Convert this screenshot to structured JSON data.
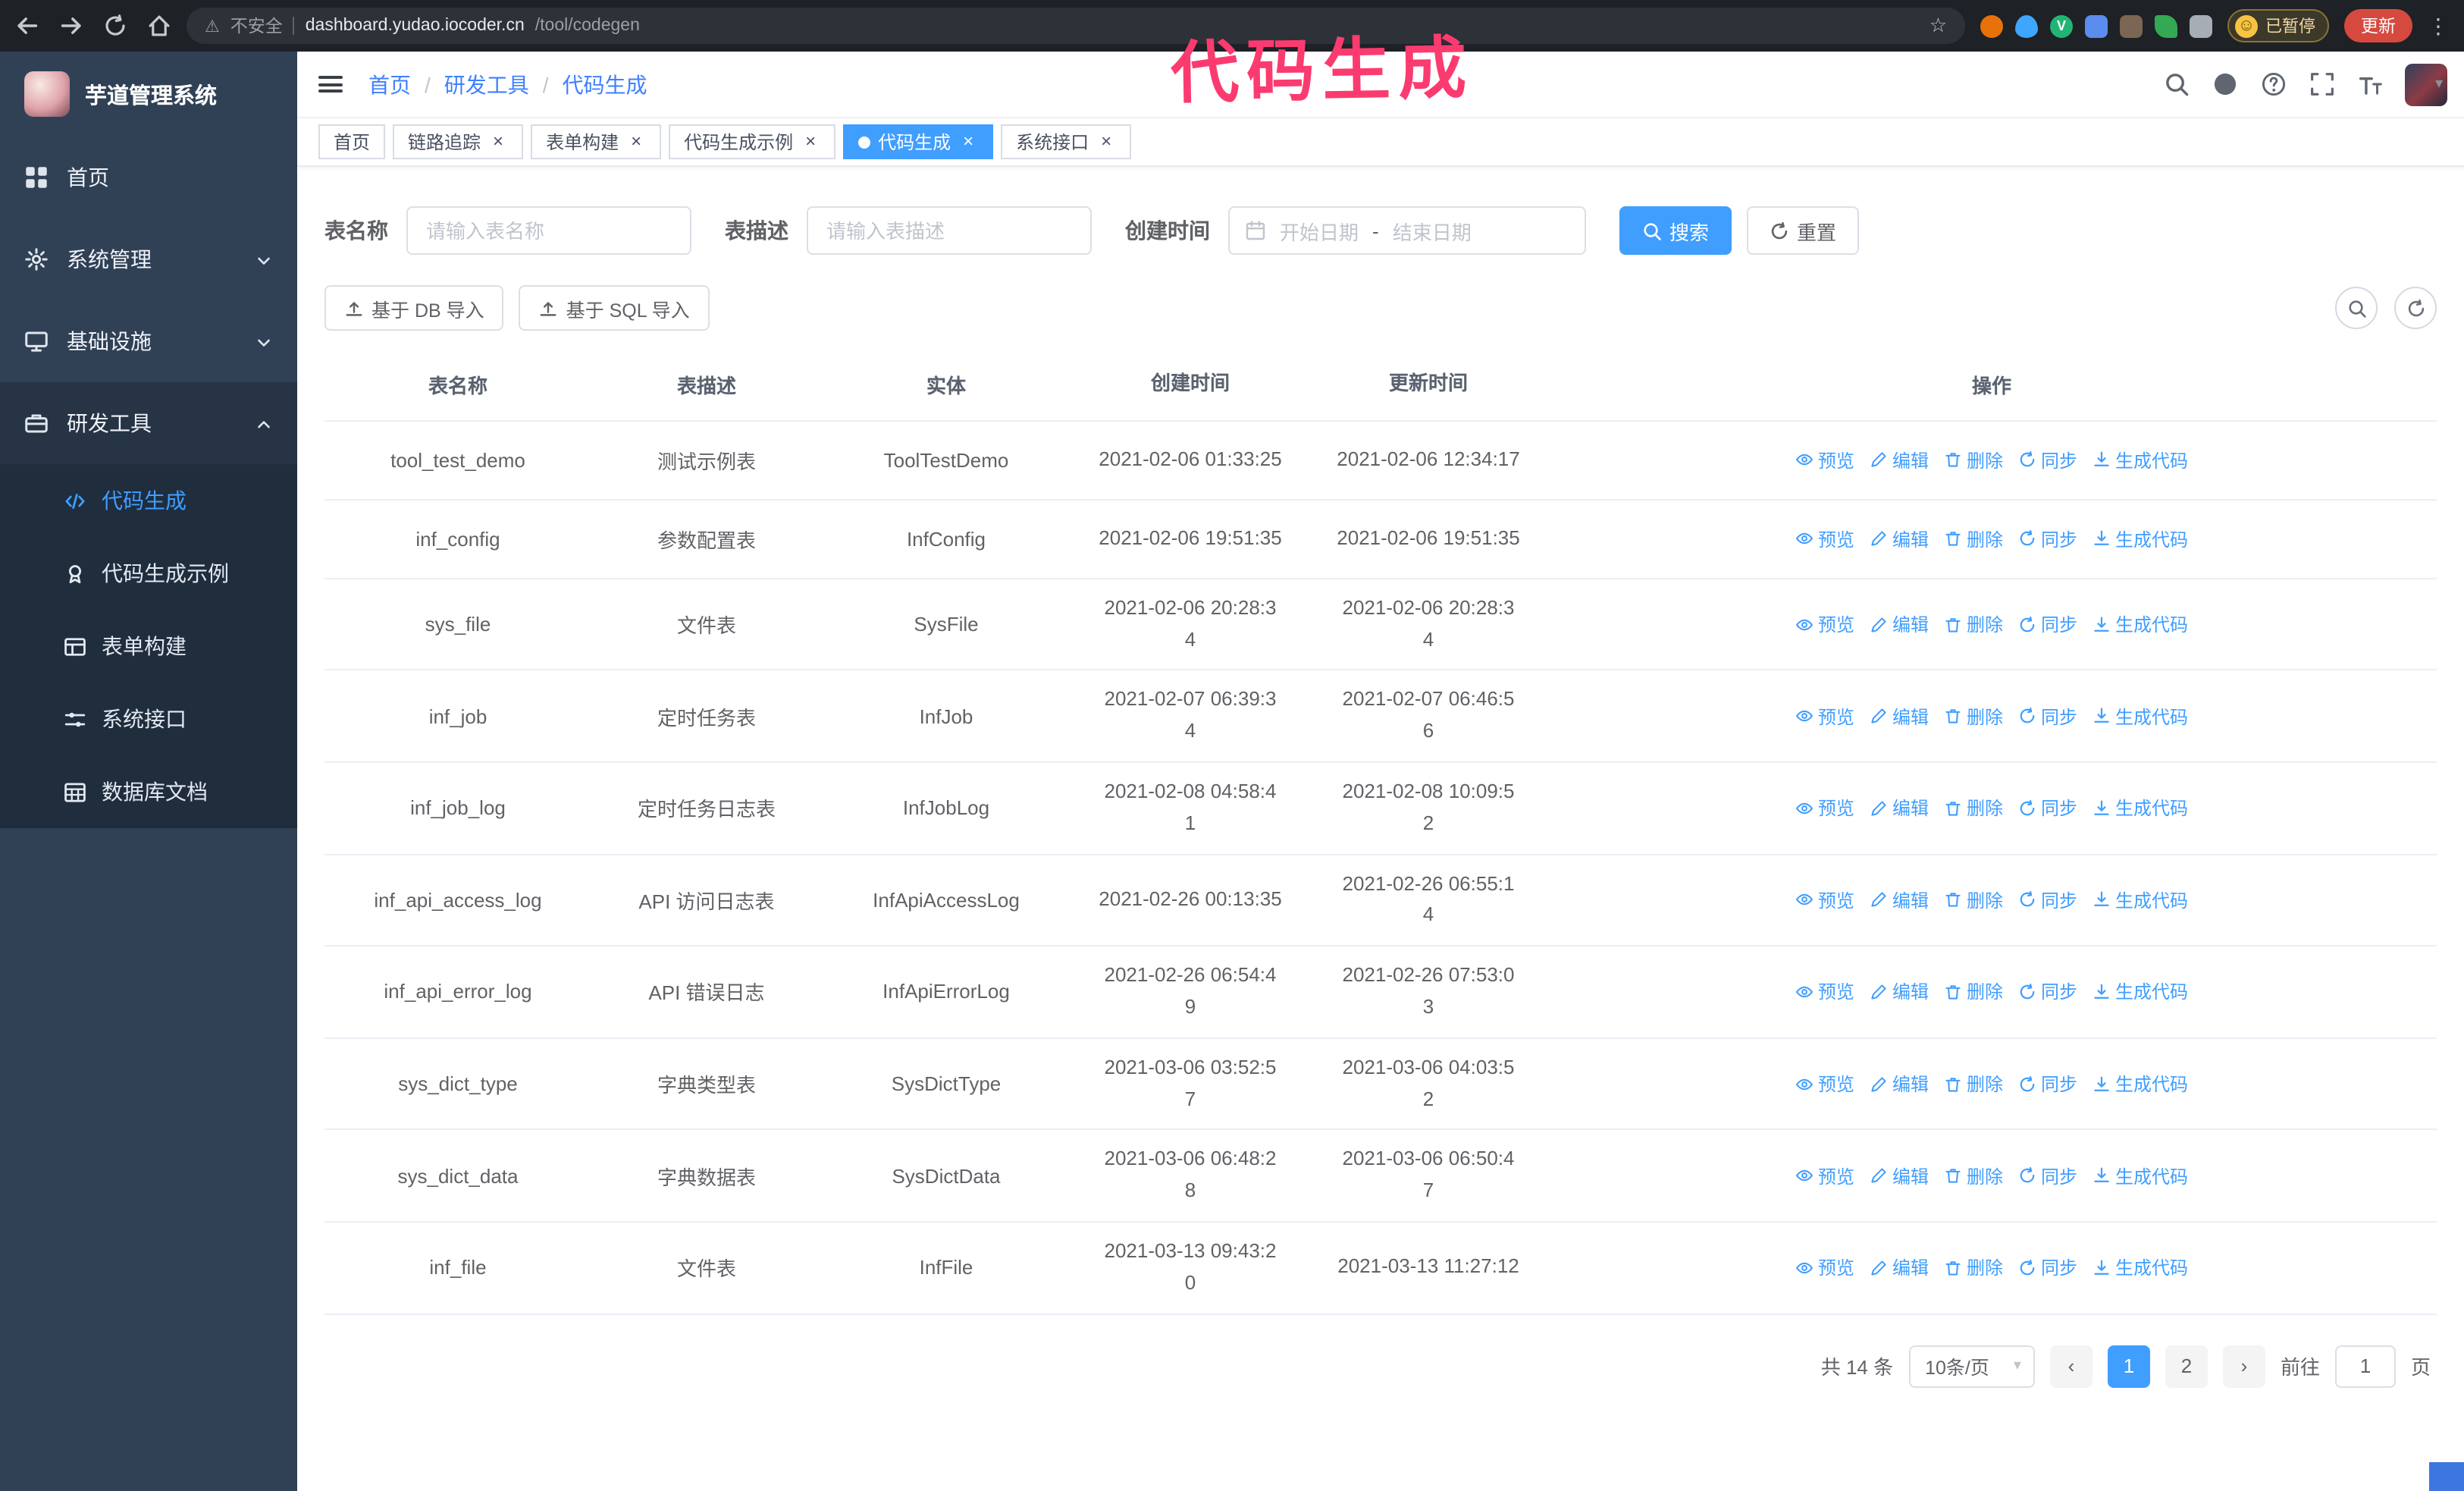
{
  "annotation": "代码生成",
  "browser": {
    "nav_icons": [
      "back-icon",
      "forward-icon",
      "refresh-icon",
      "home-icon"
    ],
    "insecure_label": "不安全",
    "url_host": "dashboard.yudao.iocoder.cn",
    "url_path": "/tool/codegen",
    "extension_icons": [
      "fox-icon",
      "droplet-icon",
      "vpn-icon",
      "users-icon",
      "screen-icon",
      "leaf-icon",
      "puzzle-icon"
    ],
    "paused_badge": "已暂停",
    "update_button": "更新"
  },
  "sidebar": {
    "logo_title": "芋道管理系统",
    "items": [
      {
        "label": "首页",
        "icon": "dashboard-icon"
      },
      {
        "label": "系统管理",
        "icon": "gear-icon",
        "chevron": "down"
      },
      {
        "label": "基础设施",
        "icon": "infra-icon",
        "chevron": "down"
      },
      {
        "label": "研发工具",
        "icon": "tools-icon",
        "chevron": "up",
        "expanded": true,
        "children": [
          {
            "label": "代码生成",
            "icon": "code-icon",
            "active": true
          },
          {
            "label": "代码生成示例",
            "icon": "example-icon"
          },
          {
            "label": "表单构建",
            "icon": "form-icon"
          },
          {
            "label": "系统接口",
            "icon": "api-icon"
          },
          {
            "label": "数据库文档",
            "icon": "dbdoc-icon"
          }
        ]
      }
    ]
  },
  "header": {
    "breadcrumb": [
      "首页",
      "研发工具",
      "代码生成"
    ],
    "icons": [
      "search-icon",
      "github-icon",
      "help-icon",
      "fullscreen-icon",
      "font-size-icon"
    ]
  },
  "tags": [
    {
      "label": "首页",
      "closable": false,
      "active": false
    },
    {
      "label": "链路追踪",
      "closable": true,
      "active": false
    },
    {
      "label": "表单构建",
      "closable": true,
      "active": false
    },
    {
      "label": "代码生成示例",
      "closable": true,
      "active": false
    },
    {
      "label": "代码生成",
      "closable": true,
      "active": true
    },
    {
      "label": "系统接口",
      "closable": true,
      "active": false
    }
  ],
  "filters": {
    "name_label": "表名称",
    "name_placeholder": "请输入表名称",
    "desc_label": "表描述",
    "desc_placeholder": "请输入表描述",
    "time_label": "创建时间",
    "start_placeholder": "开始日期",
    "range_separator": "-",
    "end_placeholder": "结束日期",
    "search_label": "搜索",
    "reset_label": "重置"
  },
  "toolbar": {
    "db_import": "基于 DB 导入",
    "sql_import": "基于 SQL 导入"
  },
  "table": {
    "columns": [
      "表名称",
      "表描述",
      "实体",
      "创建时间",
      "更新时间",
      "操作"
    ],
    "actions": [
      {
        "name": "preview",
        "label": "预览",
        "icon": "eye-icon"
      },
      {
        "name": "edit",
        "label": "编辑",
        "icon": "edit-icon"
      },
      {
        "name": "delete",
        "label": "删除",
        "icon": "delete-icon"
      },
      {
        "name": "sync",
        "label": "同步",
        "icon": "sync-icon"
      },
      {
        "name": "generate-code",
        "label": "生成代码",
        "icon": "download-icon"
      }
    ],
    "rows": [
      {
        "name": "tool_test_demo",
        "desc": "测试示例表",
        "entity": "ToolTestDemo",
        "created": "2021-02-06 01:33:25",
        "updated": "2021-02-06 12:34:17"
      },
      {
        "name": "inf_config",
        "desc": "参数配置表",
        "entity": "InfConfig",
        "created": "2021-02-06 19:51:35",
        "updated": "2021-02-06 19:51:35"
      },
      {
        "name": "sys_file",
        "desc": "文件表",
        "entity": "SysFile",
        "created": "2021-02-06 20:28:3\n4",
        "updated": "2021-02-06 20:28:3\n4"
      },
      {
        "name": "inf_job",
        "desc": "定时任务表",
        "entity": "InfJob",
        "created": "2021-02-07 06:39:3\n4",
        "updated": "2021-02-07 06:46:5\n6"
      },
      {
        "name": "inf_job_log",
        "desc": "定时任务日志表",
        "entity": "InfJobLog",
        "created": "2021-02-08 04:58:4\n1",
        "updated": "2021-02-08 10:09:5\n2"
      },
      {
        "name": "inf_api_access_log",
        "desc": "API 访问日志表",
        "entity": "InfApiAccessLog",
        "created": "2021-02-26 00:13:35",
        "updated": "2021-02-26 06:55:1\n4"
      },
      {
        "name": "inf_api_error_log",
        "desc": "API 错误日志",
        "entity": "InfApiErrorLog",
        "created": "2021-02-26 06:54:4\n9",
        "updated": "2021-02-26 07:53:0\n3"
      },
      {
        "name": "sys_dict_type",
        "desc": "字典类型表",
        "entity": "SysDictType",
        "created": "2021-03-06 03:52:5\n7",
        "updated": "2021-03-06 04:03:5\n2"
      },
      {
        "name": "sys_dict_data",
        "desc": "字典数据表",
        "entity": "SysDictData",
        "created": "2021-03-06 06:48:2\n8",
        "updated": "2021-03-06 06:50:4\n7"
      },
      {
        "name": "inf_file",
        "desc": "文件表",
        "entity": "InfFile",
        "created": "2021-03-13 09:43:2\n0",
        "updated": "2021-03-13 11:27:12"
      }
    ]
  },
  "pagination": {
    "total": "共 14 条",
    "page_size": "10条/页",
    "prev": "‹",
    "next": "›",
    "pages": [
      "1",
      "2"
    ],
    "active_page": "1",
    "goto_prefix": "前往",
    "goto_value": "1",
    "goto_suffix": "页"
  }
}
